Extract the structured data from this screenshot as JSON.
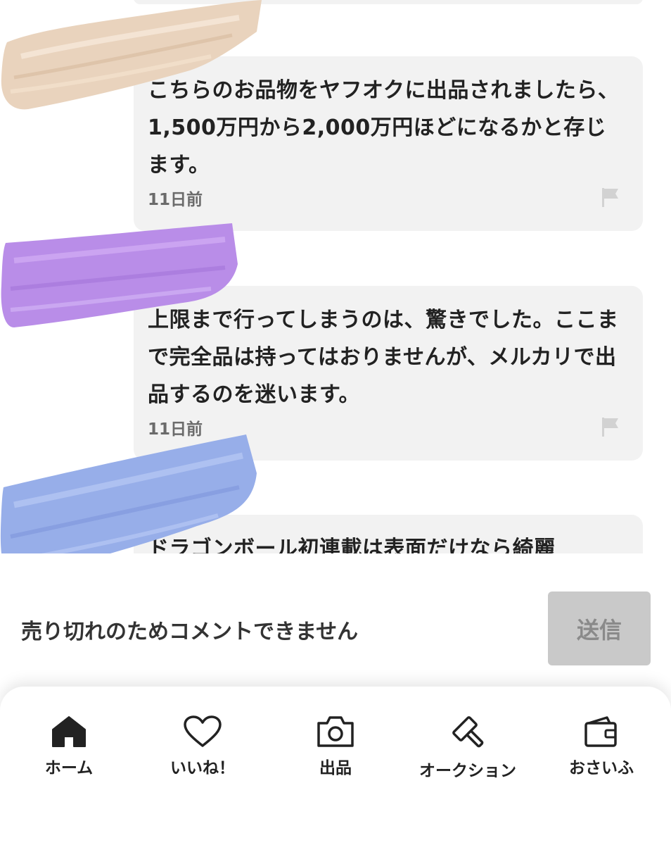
{
  "comments": [
    {
      "text": "こちらのお品物をヤフオクに出品されましたら、1,500万円から2,000万円ほどになるかと存じます。",
      "time": "11日前"
    },
    {
      "text": "上限まで行ってしまうのは、驚きでした。ここまで完全品は持ってはおりませんが、メルカリで出品するのを迷います。",
      "time": "11日前"
    },
    {
      "text": "ドラゴンボール初連載は表面だけなら綺麗"
    }
  ],
  "comment_box": {
    "disabled_message": "売り切れのためコメントできません",
    "send_label": "送信"
  },
  "tabbar": {
    "items": [
      {
        "label": "ホーム",
        "icon": "home-icon"
      },
      {
        "label": "いいね！",
        "icon": "heart-icon"
      },
      {
        "label": "出品",
        "icon": "camera-icon"
      },
      {
        "label": "オークション",
        "icon": "gavel-icon"
      },
      {
        "label": "おさいふ",
        "icon": "wallet-icon"
      }
    ]
  },
  "colors": {
    "bubble_bg": "#f2f2f2",
    "send_button_bg": "#c9c9c9",
    "swatch_beige": "#e9d3bd",
    "swatch_purple": "#b98de8",
    "swatch_blue": "#97aee9"
  }
}
